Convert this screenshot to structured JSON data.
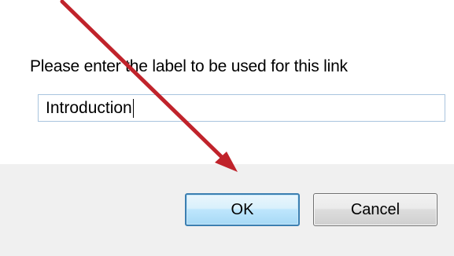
{
  "dialog": {
    "prompt": "Please enter the label to be used for this link",
    "label_input": {
      "value": "Introduction"
    },
    "buttons": {
      "ok_label": "OK",
      "cancel_label": "Cancel"
    }
  },
  "annotation": {
    "icon": "arrow-icon",
    "color": "#c0232b"
  }
}
